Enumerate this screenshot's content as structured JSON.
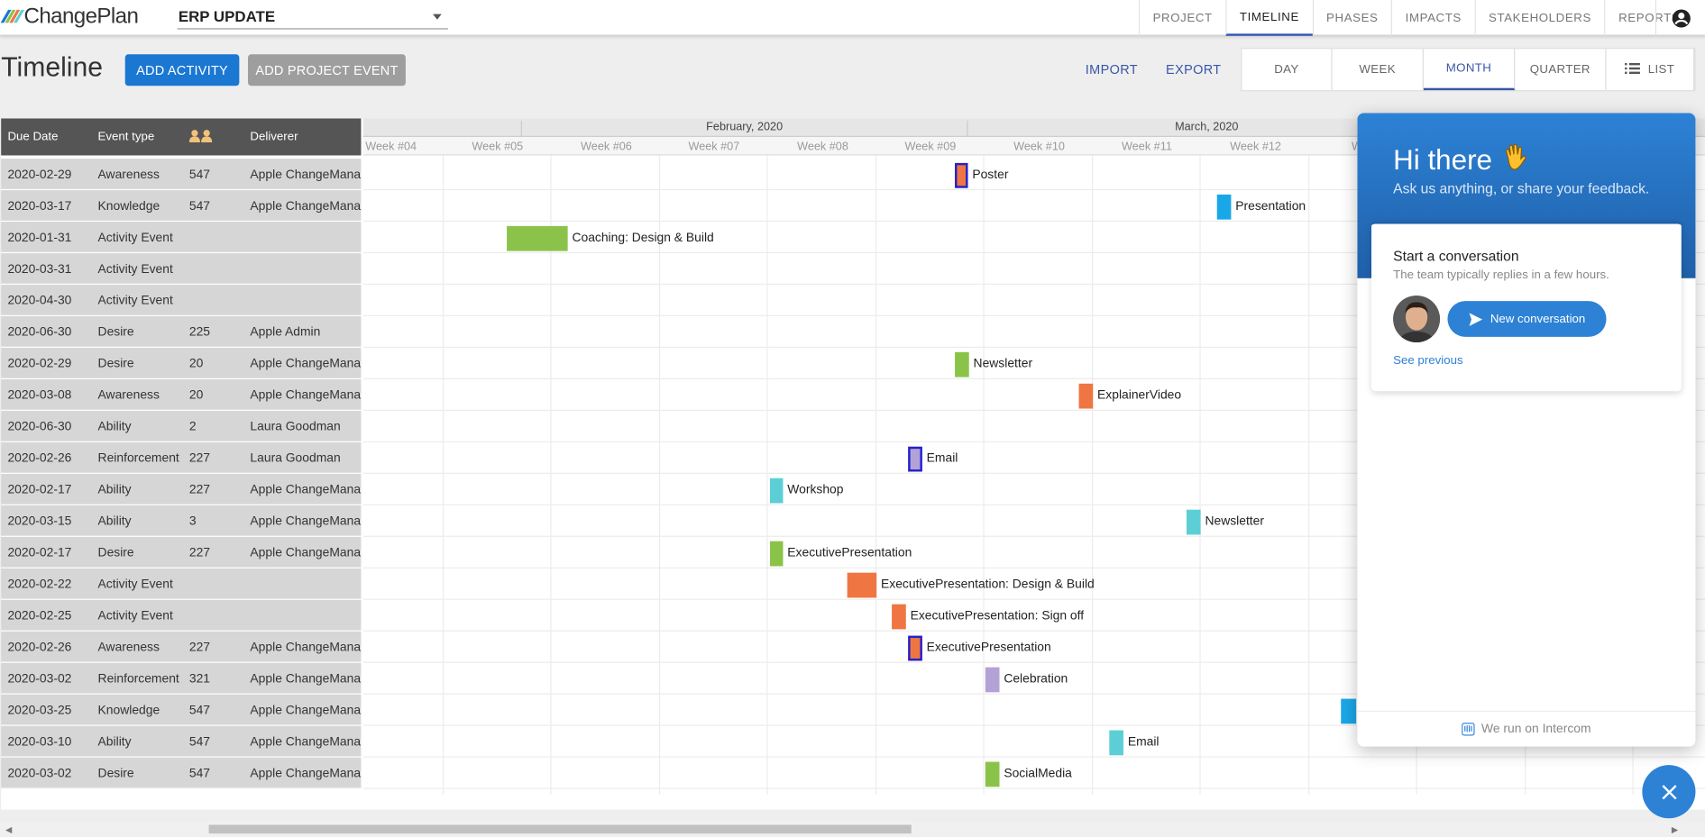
{
  "app": {
    "brand": "ChangePlan",
    "project": "ERP UPDATE"
  },
  "nav": {
    "tabs": [
      {
        "label": "PROJECT",
        "active": false
      },
      {
        "label": "TIMELINE",
        "active": true
      },
      {
        "label": "PHASES",
        "active": false
      },
      {
        "label": "IMPACTS",
        "active": false
      },
      {
        "label": "STAKEHOLDERS",
        "active": false
      },
      {
        "label": "REPORTS",
        "active": false
      }
    ]
  },
  "toolbar": {
    "title": "Timeline",
    "add_activity": "ADD ACTIVITY",
    "add_project_event": "ADD PROJECT EVENT",
    "import": "IMPORT",
    "export": "EXPORT",
    "views": [
      {
        "label": "DAY",
        "active": false
      },
      {
        "label": "WEEK",
        "active": false
      },
      {
        "label": "MONTH",
        "active": true
      },
      {
        "label": "QUARTER",
        "active": false
      },
      {
        "label": "LIST",
        "active": false
      }
    ]
  },
  "table": {
    "headers": {
      "due_date": "Due Date",
      "event_type": "Event type",
      "people_icon": "people-icon",
      "deliverer": "Deliverer"
    },
    "months": [
      "February, 2020",
      "March, 2020"
    ],
    "weeks": [
      "Week #04",
      "Week #05",
      "Week #06",
      "Week #07",
      "Week #08",
      "Week #09",
      "Week #10",
      "Week #11",
      "Week #12",
      "Wee"
    ],
    "rows": [
      {
        "date": "2020-02-29",
        "type": "Awareness",
        "count": "547",
        "deliverer": "Apple ChangeManag",
        "bar": {
          "label": "Poster",
          "color": "#ef7542",
          "sel": true
        }
      },
      {
        "date": "2020-03-17",
        "type": "Knowledge",
        "count": "547",
        "deliverer": "Apple ChangeManag",
        "bar": {
          "label": "Presentation",
          "color": "#1aa7e8",
          "sel": false
        }
      },
      {
        "date": "2020-01-31",
        "type": "Activity Event",
        "count": "",
        "deliverer": "",
        "bar": {
          "label": "Coaching: Design & Build",
          "color": "#8bc34a",
          "sel": false
        }
      },
      {
        "date": "2020-03-31",
        "type": "Activity Event",
        "count": "",
        "deliverer": "",
        "bar": null
      },
      {
        "date": "2020-04-30",
        "type": "Activity Event",
        "count": "",
        "deliverer": "",
        "bar": null
      },
      {
        "date": "2020-06-30",
        "type": "Desire",
        "count": "225",
        "deliverer": "Apple Admin",
        "bar": null
      },
      {
        "date": "2020-02-29",
        "type": "Desire",
        "count": "20",
        "deliverer": "Apple ChangeManag",
        "bar": {
          "label": "Newsletter",
          "color": "#8bc34a",
          "sel": false
        }
      },
      {
        "date": "2020-03-08",
        "type": "Awareness",
        "count": "20",
        "deliverer": "Apple ChangeManag",
        "bar": {
          "label": "ExplainerVideo",
          "color": "#ef7542",
          "sel": false
        }
      },
      {
        "date": "2020-06-30",
        "type": "Ability",
        "count": "2",
        "deliverer": "Laura Goodman",
        "bar": null
      },
      {
        "date": "2020-02-26",
        "type": "Reinforcement",
        "count": "227",
        "deliverer": "Laura Goodman",
        "bar": {
          "label": "Email",
          "color": "#b3a2d6",
          "sel": true
        }
      },
      {
        "date": "2020-02-17",
        "type": "Ability",
        "count": "227",
        "deliverer": "Apple ChangeManag",
        "bar": {
          "label": "Workshop",
          "color": "#5ccfd6",
          "sel": false
        }
      },
      {
        "date": "2020-03-15",
        "type": "Ability",
        "count": "3",
        "deliverer": "Apple ChangeManag",
        "bar": {
          "label": "Newsletter",
          "color": "#5ccfd6",
          "sel": false
        }
      },
      {
        "date": "2020-02-17",
        "type": "Desire",
        "count": "227",
        "deliverer": "Apple ChangeManag",
        "bar": {
          "label": "ExecutivePresentation",
          "color": "#8bc34a",
          "sel": false
        }
      },
      {
        "date": "2020-02-22",
        "type": "Activity Event",
        "count": "",
        "deliverer": "",
        "bar": {
          "label": "ExecutivePresentation: Design & Build",
          "color": "#ef7542",
          "sel": false
        }
      },
      {
        "date": "2020-02-25",
        "type": "Activity Event",
        "count": "",
        "deliverer": "",
        "bar": {
          "label": "ExecutivePresentation: Sign off",
          "color": "#ef7542",
          "sel": false
        }
      },
      {
        "date": "2020-02-26",
        "type": "Awareness",
        "count": "227",
        "deliverer": "Apple ChangeManag",
        "bar": {
          "label": "ExecutivePresentation",
          "color": "#ef7542",
          "sel": true
        }
      },
      {
        "date": "2020-03-02",
        "type": "Reinforcement",
        "count": "321",
        "deliverer": "Apple ChangeManag",
        "bar": {
          "label": "Celebration",
          "color": "#b3a2d6",
          "sel": false
        }
      },
      {
        "date": "2020-03-25",
        "type": "Knowledge",
        "count": "547",
        "deliverer": "Apple ChangeManag",
        "bar": {
          "label": "",
          "color": "#1aa7e8",
          "sel": false
        }
      },
      {
        "date": "2020-03-10",
        "type": "Ability",
        "count": "547",
        "deliverer": "Apple ChangeManag",
        "bar": {
          "label": "Email",
          "color": "#5ccfd6",
          "sel": false
        }
      },
      {
        "date": "2020-03-02",
        "type": "Desire",
        "count": "547",
        "deliverer": "Apple ChangeManag",
        "bar": {
          "label": "SocialMedia",
          "color": "#8bc34a",
          "sel": false
        }
      }
    ]
  },
  "intercom": {
    "greeting": "Hi there",
    "wave_icon": "waving-hand-icon",
    "subtitle": "Ask us anything, or share your feedback.",
    "card_title": "Start a conversation",
    "card_sub": "The team typically replies in a few hours.",
    "new_conversation": "New conversation",
    "see_previous": "See previous",
    "footer": "We run on Intercom"
  }
}
